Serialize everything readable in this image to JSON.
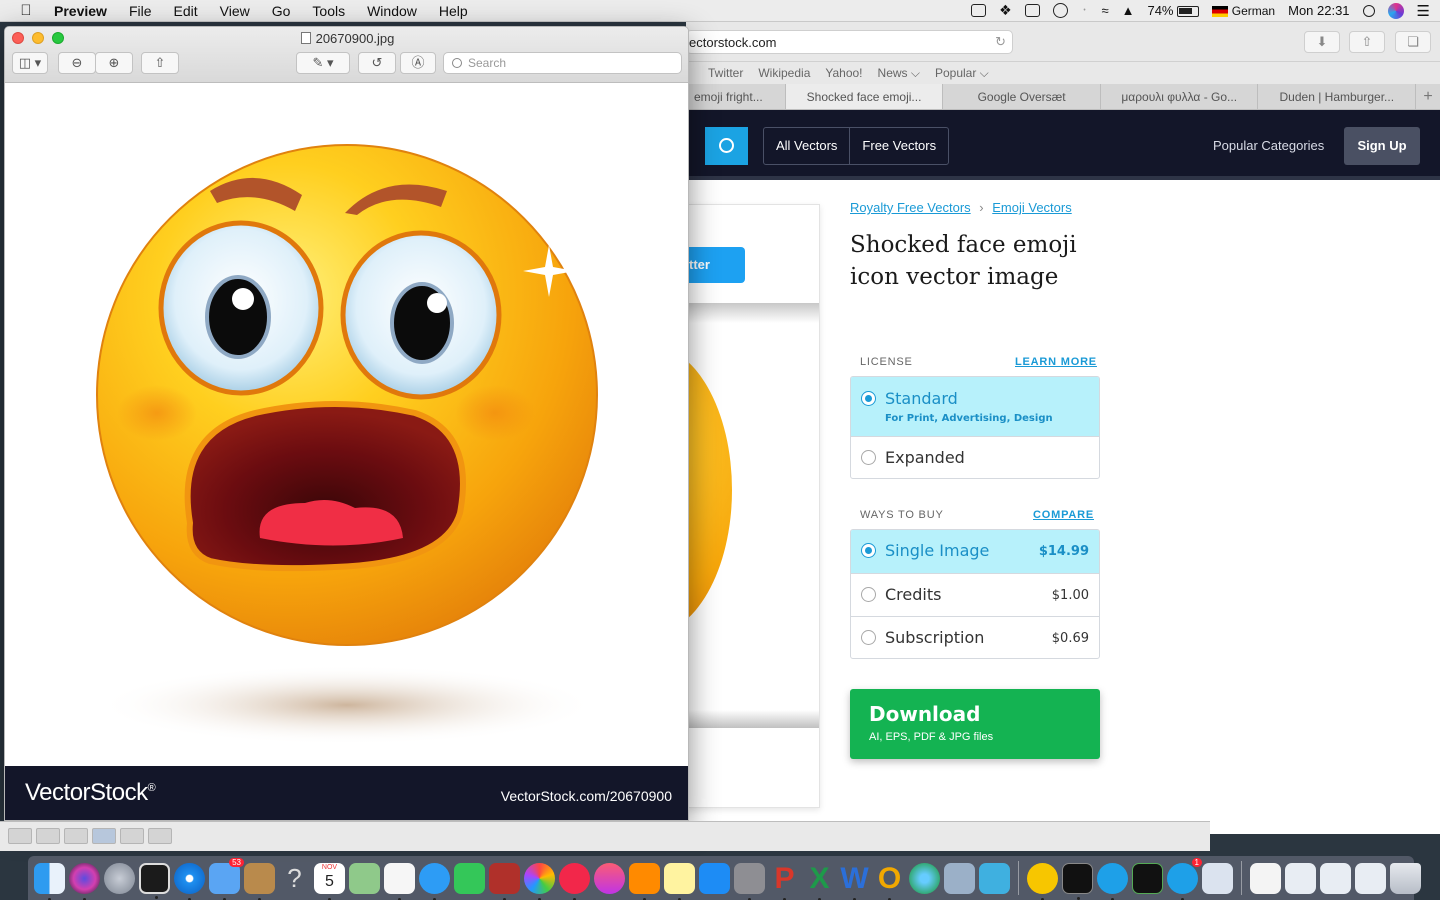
{
  "menubar": {
    "app_name": "Preview",
    "items": [
      "File",
      "Edit",
      "View",
      "Go",
      "Tools",
      "Window",
      "Help"
    ],
    "battery": "74%",
    "input_language": "German",
    "clock": "Mon 22:31"
  },
  "safari": {
    "url": "ectorstock.com",
    "favorites": [
      "Twitter",
      "Wikipedia",
      "Yahoo!",
      "News ⌵",
      "Popular ⌵"
    ],
    "tabs": [
      "emoji fright...",
      "Shocked face emoji...",
      "Google Oversæt",
      "μαρουλι φυλλα - Go...",
      "Duden | Hamburger..."
    ],
    "active_tab_index": 1
  },
  "vectorstock": {
    "nav": {
      "all_vectors": "All Vectors",
      "free_vectors": "Free Vectors",
      "popular_categories": "Popular Categories",
      "sign_up": "Sign Up"
    },
    "twitter_button_fragment": "tter",
    "breadcrumb": [
      "Royalty Free Vectors",
      "Emoji Vectors"
    ],
    "breadcrumb_separator": "›",
    "title": "Shocked face emoji icon vector image",
    "license": {
      "heading": "LICENSE",
      "link": "LEARN MORE",
      "options": [
        {
          "label": "Standard",
          "sub": "For Print, Advertising, Design",
          "selected": true
        },
        {
          "label": "Expanded",
          "selected": false
        }
      ]
    },
    "ways_to_buy": {
      "heading": "WAYS TO BUY",
      "link": "COMPARE",
      "options": [
        {
          "label": "Single Image",
          "price": "$14.99",
          "selected": true
        },
        {
          "label": "Credits",
          "price": "$1.00",
          "selected": false
        },
        {
          "label": "Subscription",
          "price": "$0.69",
          "selected": false
        }
      ]
    },
    "download": {
      "title": "Download",
      "formats": "AI, EPS, PDF & JPG files"
    }
  },
  "preview": {
    "window_title": "20670900.jpg",
    "search_placeholder": "Search",
    "footer_logo": "VectorStock",
    "footer_logo_mark": "®",
    "footer_link": "VectorStock.com/20670900"
  },
  "dock": {
    "badges": {
      "mail": "53",
      "skype": "1"
    },
    "calendar_month": "NOV",
    "calendar_day": "5"
  },
  "colors": {
    "accent_blue": "#1ba3e3",
    "download_green": "#14b352",
    "vectorstock_navy": "#131629",
    "selected_option_bg": "#b7f1fb"
  }
}
